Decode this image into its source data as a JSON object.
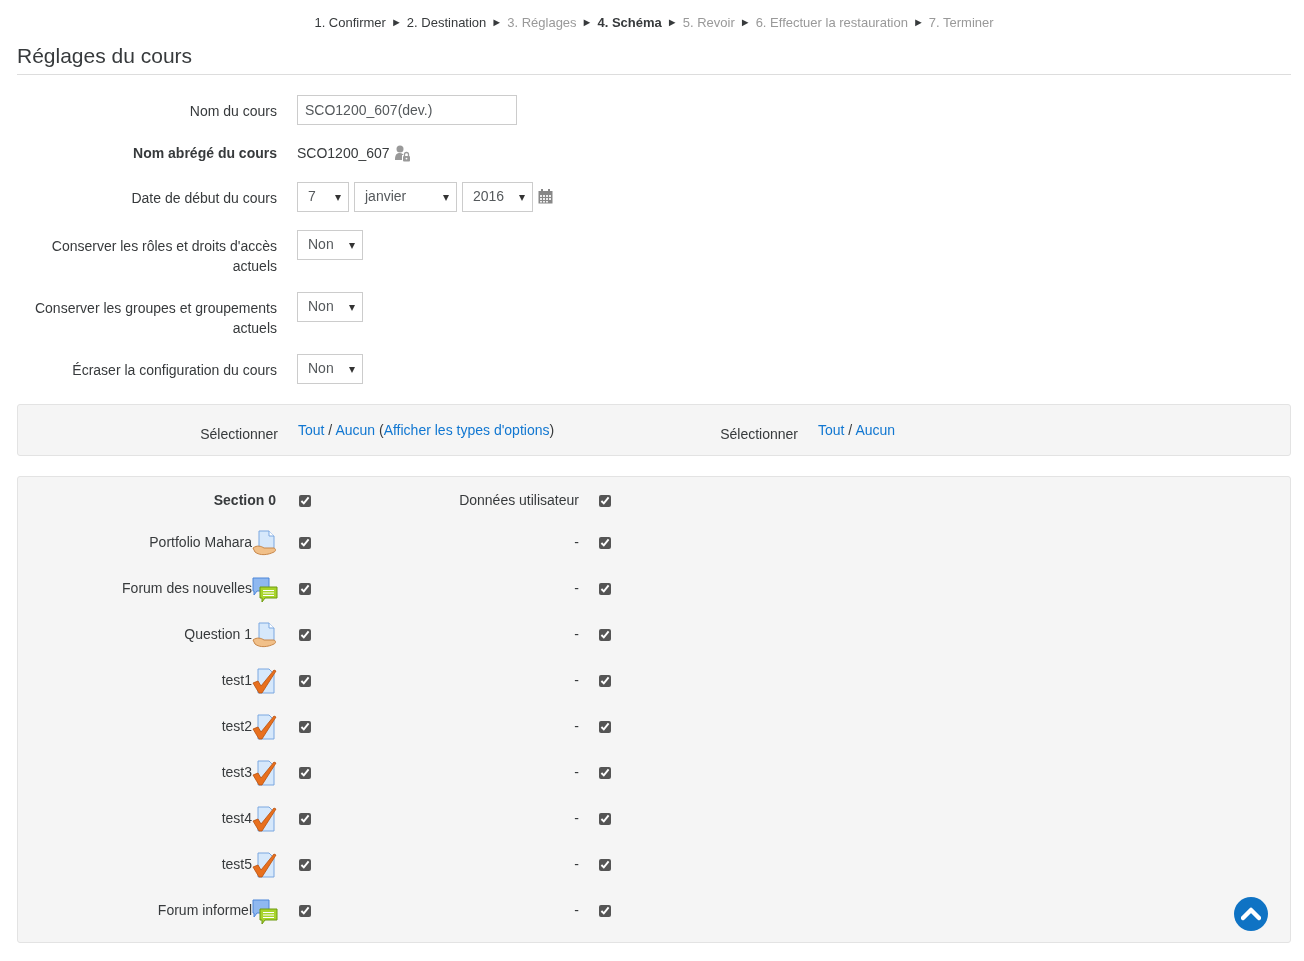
{
  "steps": [
    {
      "label": "1. Confirmer",
      "kind": "done"
    },
    {
      "label": "2. Destination",
      "kind": "done"
    },
    {
      "label": "3. Réglages",
      "kind": "pending"
    },
    {
      "label": "4. Schéma",
      "kind": "current"
    },
    {
      "label": "5. Revoir",
      "kind": "pending"
    },
    {
      "label": "6. Effectuer la restauration",
      "kind": "pending"
    },
    {
      "label": "7. Terminer",
      "kind": "pending"
    }
  ],
  "step_separator": "►",
  "heading": "Réglages du cours",
  "fields": [
    {
      "label": "Nom du cours",
      "kind": "text",
      "value": "SCO1200_607(dev.)",
      "bold": false
    },
    {
      "label": "Nom abrégé du cours",
      "kind": "static",
      "value": "SCO1200_607",
      "bold": true
    },
    {
      "label": "Date de début du cours",
      "kind": "date",
      "day": "7",
      "month": "janvier",
      "year": "2016",
      "bold": false
    },
    {
      "label": "Conserver les rôles et droits d'accès actuels",
      "kind": "select",
      "value": "Non",
      "bold": false
    },
    {
      "label": "Conserver les groupes et groupements actuels",
      "kind": "select",
      "value": "Non",
      "bold": false
    },
    {
      "label": "Écraser la configuration du cours",
      "kind": "select",
      "value": "Non",
      "bold": false
    }
  ],
  "select_bar": {
    "slash": "/",
    "paren_open": "(",
    "paren_close": ")",
    "slash_right": "/",
    "left_label": "Sélectionner",
    "left_all": "Tout",
    "left_none": "Aucun",
    "show_types": "Afficher les types d'options",
    "right_label": "Sélectionner",
    "right_all": "Tout",
    "right_none": "Aucun"
  },
  "items": [
    {
      "label": "Section 0",
      "kind": "section",
      "checked": true,
      "userdata_label": "Données utilisateur",
      "userdata_checked": true
    },
    {
      "label": "Portfolio Mahara",
      "kind": "assign",
      "checked": true,
      "userdata_label": "-",
      "userdata_checked": true
    },
    {
      "label": "Forum des nouvelles",
      "kind": "forum",
      "checked": true,
      "userdata_label": "-",
      "userdata_checked": true
    },
    {
      "label": "Question 1",
      "kind": "assign",
      "checked": true,
      "userdata_label": "-",
      "userdata_checked": true
    },
    {
      "label": "test1",
      "kind": "quiz",
      "checked": true,
      "userdata_label": "-",
      "userdata_checked": true
    },
    {
      "label": "test2",
      "kind": "quiz",
      "checked": true,
      "userdata_label": "-",
      "userdata_checked": true
    },
    {
      "label": "test3",
      "kind": "quiz",
      "checked": true,
      "userdata_label": "-",
      "userdata_checked": true
    },
    {
      "label": "test4",
      "kind": "quiz",
      "checked": true,
      "userdata_label": "-",
      "userdata_checked": true
    },
    {
      "label": "test5",
      "kind": "quiz",
      "checked": true,
      "userdata_label": "-",
      "userdata_checked": true
    },
    {
      "label": "Forum informel",
      "kind": "forum",
      "checked": true,
      "userdata_label": "-",
      "userdata_checked": true
    }
  ]
}
